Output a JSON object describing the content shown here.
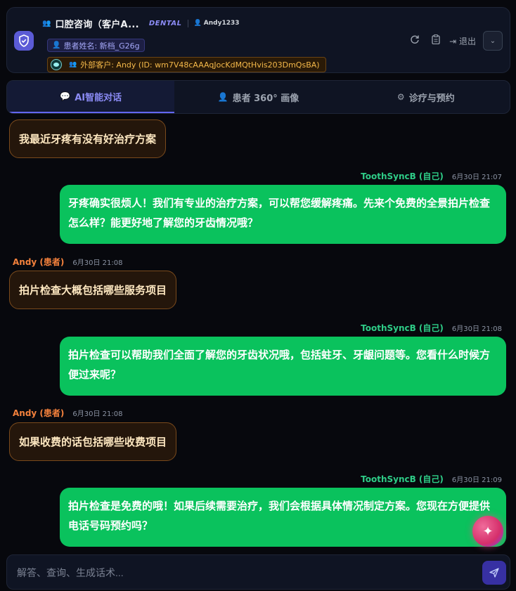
{
  "header": {
    "title": "口腔咨询（客户A...",
    "tag": "DENTAL",
    "username": "Andy1233",
    "patient_badge": "患者姓名: 新档_G26g",
    "external_badge": "外部客户: Andy (ID: wm7V48cAAAqJocKdMQtHvis203DmQsBA)",
    "logout_label": "退出"
  },
  "tabs": [
    {
      "label": "AI智能对话",
      "icon": "chat-icon",
      "active": true
    },
    {
      "label": "患者 360° 画像",
      "icon": "person-icon",
      "active": false
    },
    {
      "label": "诊疗与预约",
      "icon": "gear-icon",
      "active": false
    }
  ],
  "messages": [
    {
      "side": "left",
      "text": "我最近牙疼有没有好治疗方案"
    },
    {
      "side": "right",
      "sender": "ToothSyncB (自己)",
      "time": "6月30日 21:07",
      "text": "牙疼确实很烦人！我们有专业的治疗方案，可以帮您缓解疼痛。先来个免费的全景拍片检查怎么样？能更好地了解您的牙齿情况哦？"
    },
    {
      "side": "left",
      "sender": "Andy (患者)",
      "time": "6月30日 21:08",
      "text": "拍片检查大概包括哪些服务项目"
    },
    {
      "side": "right",
      "sender": "ToothSyncB (自己)",
      "time": "6月30日 21:08",
      "text": "拍片检查可以帮助我们全面了解您的牙齿状况哦，包括蛀牙、牙龈问题等。您看什么时候方便过来呢？"
    },
    {
      "side": "left",
      "sender": "Andy (患者)",
      "time": "6月30日 21:08",
      "text": "如果收费的话包括哪些收费项目"
    },
    {
      "side": "right",
      "sender": "ToothSyncB (自己)",
      "time": "6月30日 21:09",
      "text": "拍片检查是免费的哦！如果后续需要治疗，我们会根据具体情况制定方案。您现在方便提供电话号码预约吗？"
    }
  ],
  "input": {
    "placeholder": "解答、查询、生成话术..."
  },
  "colors": {
    "accent": "#6366f1",
    "bot_bubble": "#0ac25d",
    "patient_bubble_border": "#7a4a1c",
    "patient_name": "#f4813c"
  }
}
